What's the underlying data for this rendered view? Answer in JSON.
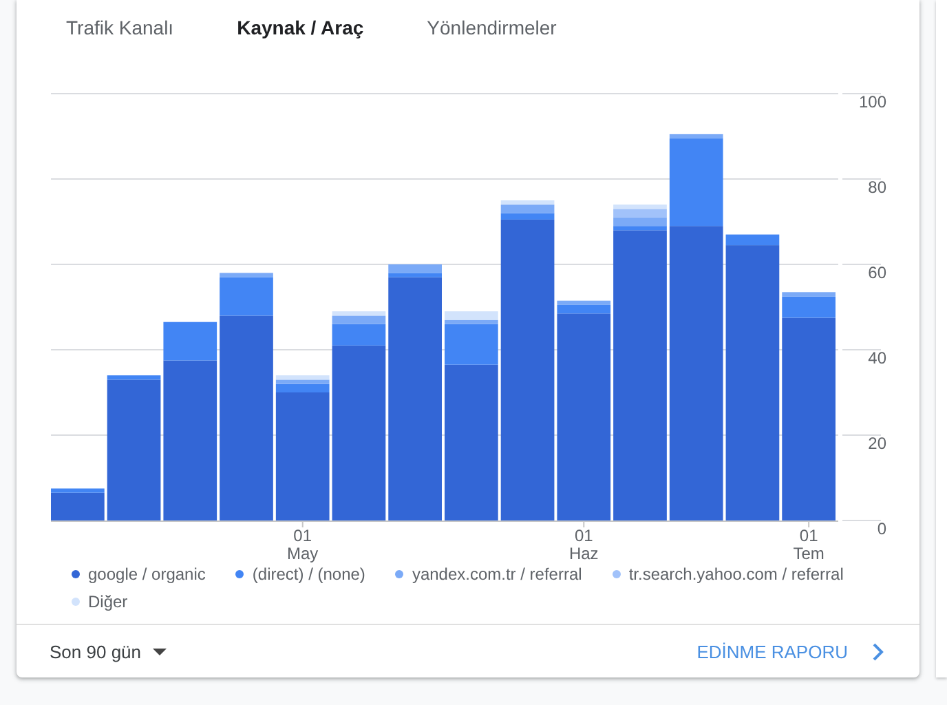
{
  "tabs": [
    {
      "label": "Trafik Kanalı",
      "selected": false
    },
    {
      "label": "Kaynak / Araç",
      "selected": true
    },
    {
      "label": "Yönlendirmeler",
      "selected": false
    }
  ],
  "chart_data": {
    "type": "bar",
    "stacked": true,
    "categories": [
      null,
      null,
      null,
      null,
      "01 May",
      null,
      null,
      null,
      null,
      "01 Haz",
      null,
      null,
      null,
      "01 Tem"
    ],
    "ylim": [
      0,
      100
    ],
    "grid": true,
    "yticks": [
      0,
      20,
      40,
      60,
      80,
      100
    ],
    "series": [
      {
        "name": "google / organic",
        "color": "#3366d6",
        "values": [
          6.5,
          33,
          37.5,
          48,
          30,
          41,
          57,
          36.5,
          70.5,
          48.5,
          68,
          69,
          64.5,
          47.5
        ]
      },
      {
        "name": "(direct) / (none)",
        "color": "#4285f4",
        "values": [
          1,
          1,
          9,
          9,
          2,
          5,
          1,
          9.5,
          1.5,
          2,
          1,
          20.5,
          2.5,
          5
        ]
      },
      {
        "name": "yandex.com.tr / referral",
        "color": "#7baaf7",
        "values": [
          0,
          0,
          0,
          1,
          1,
          2,
          2,
          1,
          2,
          1,
          2,
          1,
          0,
          1
        ]
      },
      {
        "name": "tr.search.yahoo.com / referral",
        "color": "#a1c2fa",
        "values": [
          0,
          0,
          0,
          0,
          0,
          0,
          0,
          0,
          0,
          0,
          2,
          0,
          0,
          0
        ]
      },
      {
        "name": "Diğer",
        "color": "#d2e3fc",
        "values": [
          0,
          0,
          0,
          0,
          1,
          1,
          0,
          2,
          1,
          0,
          1,
          0,
          0,
          0
        ]
      }
    ]
  },
  "footer": {
    "period": "Son 90 gün",
    "report_link": "EDİNME RAPORU"
  }
}
